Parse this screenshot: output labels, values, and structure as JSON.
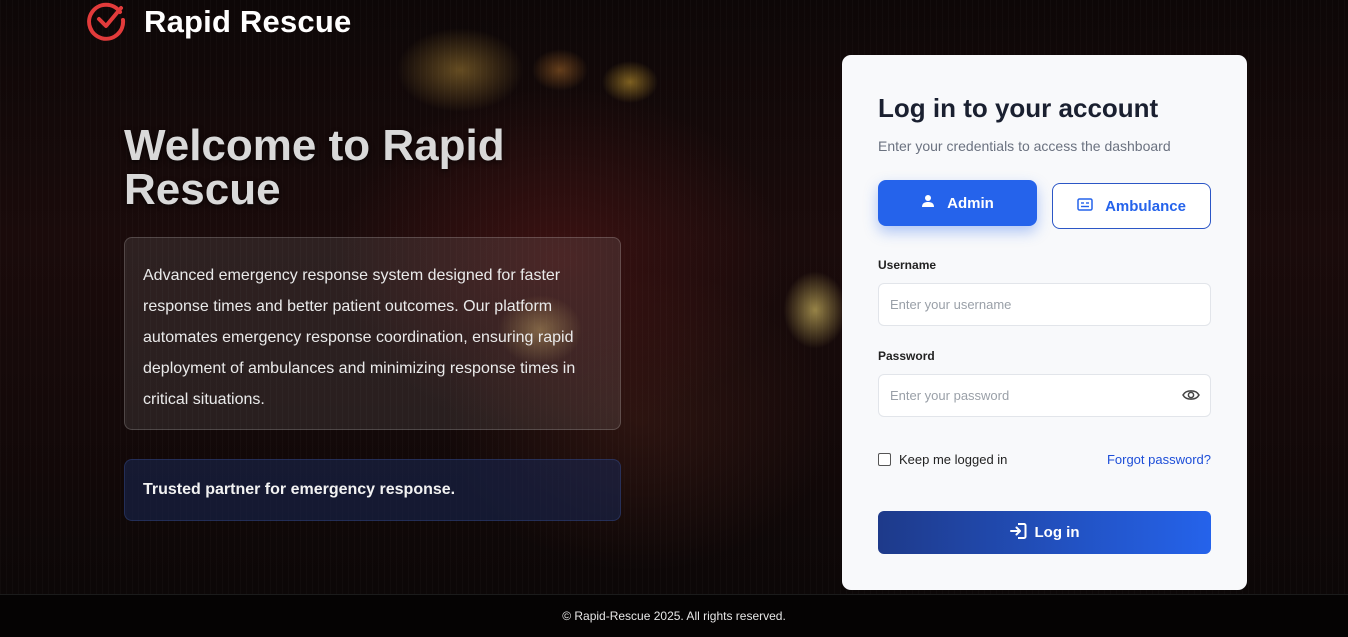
{
  "brand": {
    "name": "Rapid Rescue",
    "icon": "check-circle-icon",
    "color": "#e23b3b"
  },
  "hero": {
    "title": "Welcome to Rapid Rescue",
    "description": "Advanced emergency response system designed for faster response times and better patient outcomes. Our platform automates emergency response coordination, ensuring rapid deployment of ambulances and minimizing response times in critical situations.",
    "trust": "Trusted partner for emergency response."
  },
  "login": {
    "title": "Log in to your account",
    "subtitle": "Enter your credentials to access the dashboard",
    "roles": [
      {
        "label": "Admin",
        "icon": "user-icon",
        "selected": true
      },
      {
        "label": "Ambulance",
        "icon": "id-card-icon",
        "selected": false
      }
    ],
    "username": {
      "label": "Username",
      "placeholder": "Enter your username",
      "value": ""
    },
    "password": {
      "label": "Password",
      "placeholder": "Enter your password",
      "value": "",
      "icon": "eye-icon"
    },
    "remember_label": "Keep me logged in",
    "remember_checked": false,
    "forgot_label": "Forgot password?",
    "submit_label": "Log in",
    "submit_icon": "login-icon"
  },
  "footer": {
    "text": "© Rapid-Rescue 2025. All rights reserved."
  },
  "colors": {
    "primary": "#2563eb",
    "primary_dark": "#1e3a8a",
    "brand_red": "#e23b3b"
  }
}
